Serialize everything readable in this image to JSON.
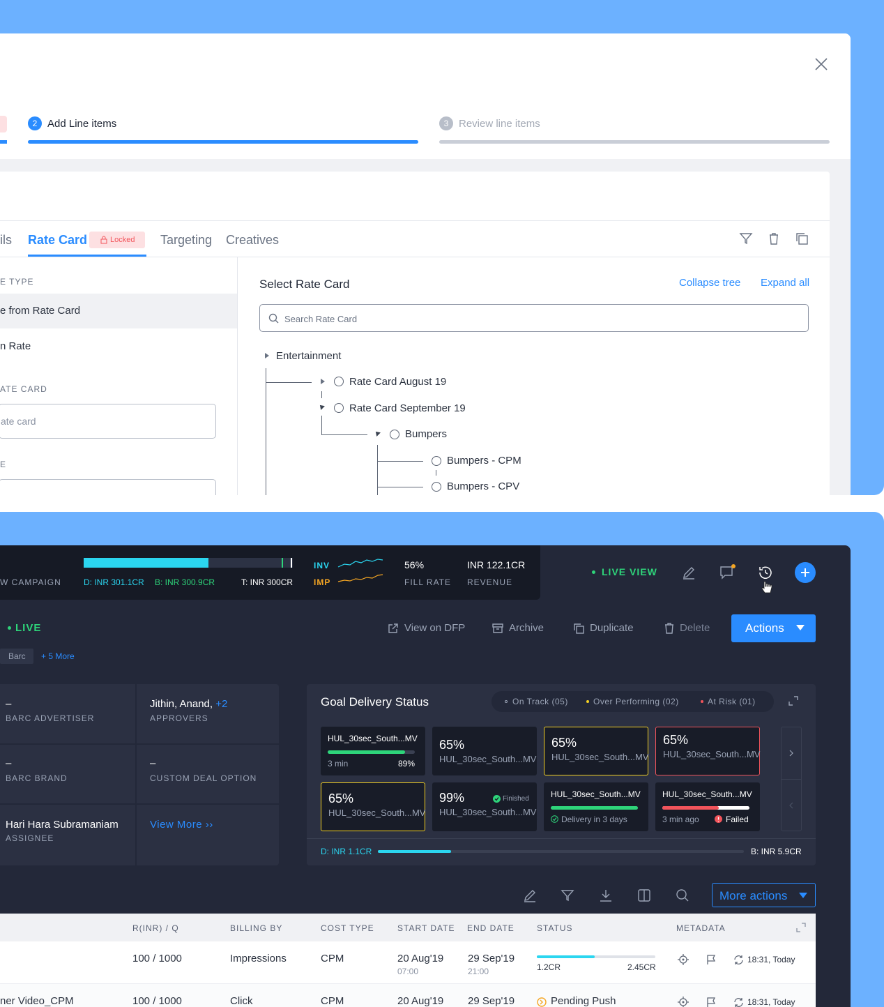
{
  "wizard": {
    "step2_num": "2",
    "step2_label": "Add Line items",
    "step3_num": "3",
    "step3_label": "Review line items"
  },
  "tabs": {
    "details": "ils",
    "rate_card": "Rate Card",
    "locked": "Locked",
    "targeting": "Targeting",
    "creatives": "Creatives"
  },
  "left": {
    "type_label": "E TYPE",
    "opt1": "e from Rate Card",
    "opt2": "n Rate",
    "ratecard_label": "ATE CARD",
    "ratecard_placeholder": "ate card",
    "e_label": "E"
  },
  "rate": {
    "title": "Select Rate Card",
    "collapse": "Collapse tree",
    "expand": "Expand all",
    "search_placeholder": "Search Rate Card",
    "tree": [
      "Entertainment",
      "Rate Card August 19",
      "Rate Card September 19",
      "Bumpers",
      "Bumpers - CPM",
      "Bumpers - CPV"
    ]
  },
  "top": {
    "campaign": "W CAMPAIGN",
    "delivered": "D: INR 301.1CR",
    "booked": "B: INR 300.9CR",
    "target": "T: INR 300CR",
    "inv": "INV",
    "imp": "IMP",
    "fill_value": "56%",
    "fill_label": "FILL RATE",
    "revenue_value": "INR 122.1CR",
    "revenue_label": "REVENUE",
    "live_view": "LIVE VIEW",
    "progress_fraction": 0.595
  },
  "toolbar": {
    "live": "LIVE",
    "view_dfp": "View on DFP",
    "archive": "Archive",
    "duplicate": "Duplicate",
    "delete": "Delete",
    "actions": "Actions"
  },
  "tags": {
    "barc": "Barc",
    "more": "+ 5 More"
  },
  "info": {
    "dash1": "–",
    "adv": "BARC ADVERTISER",
    "approvers_name": "Jithin, Anand,",
    "approvers_more": "+2",
    "approvers": "APPROVERS",
    "dash2": "–",
    "brand": "BARC BRAND",
    "dash3": "–",
    "deal": "CUSTOM DEAL OPTION",
    "assignee_name": "Hari Hara Subramaniam",
    "assignee": "ASSIGNEE",
    "view_more": "View More ››"
  },
  "goal": {
    "title": "Goal Delivery Status",
    "on_track": "On Track (05)",
    "over": "Over Performing (02)",
    "risk": "At Risk (01)",
    "delivered": "D: INR 1.1CR",
    "booked": "B: INR 5.9CR",
    "progress_fraction": 0.2,
    "tiles": [
      {
        "name": "HUL_30sec_South...MV",
        "time": "3 min",
        "pct": "89%",
        "fill": 0.89
      },
      {
        "pct": "65%",
        "name": "HUL_30sec_South...MV"
      },
      {
        "pct": "65%",
        "name": "HUL_30sec_South...MV"
      },
      {
        "pct": "65%",
        "name": "HUL_30sec_South...MV"
      },
      {
        "pct": "65%",
        "name": "HUL_30sec_South...MV"
      },
      {
        "pct": "99%",
        "badge": "Finished",
        "name": "HUL_30sec_South...MV"
      },
      {
        "name": "HUL_30sec_South...MV",
        "note": "Delivery in 3 days",
        "fill": 1.0
      },
      {
        "name": "HUL_30sec_South...MV",
        "time": "3 min ago",
        "status": "Failed",
        "fill": 0.65
      }
    ]
  },
  "table": {
    "more_actions": "More actions",
    "headers": [
      "R(INR) / Q",
      "BILLING BY",
      "COST TYPE",
      "START DATE",
      "END DATE",
      "STATUS",
      "METADATA"
    ],
    "rows": [
      {
        "name": "",
        "rq": "100 / 1000",
        "billing": "Impressions",
        "cost": "CPM",
        "start": "20 Aug'19",
        "start_t": "07:00",
        "end": "29 Sep'19",
        "end_t": "21:00",
        "s_left": "1.2CR",
        "s_right": "2.45CR",
        "status_fill": 0.49,
        "meta": "18:31, Today"
      },
      {
        "name": "ner Video_CPM",
        "rq": "100 / 1000",
        "billing": "Click",
        "cost": "CPM",
        "start": "20 Aug'19",
        "end": "29 Sep'19",
        "status": "Pending Push",
        "meta": "18:31, Today"
      }
    ]
  },
  "colors": {
    "bg_blue": "#6cb1ff",
    "accent": "#2a8cff",
    "live_green": "#2ed47a",
    "cyan": "#2bd6f0",
    "amber": "#f5a623",
    "red": "#f2545b"
  }
}
